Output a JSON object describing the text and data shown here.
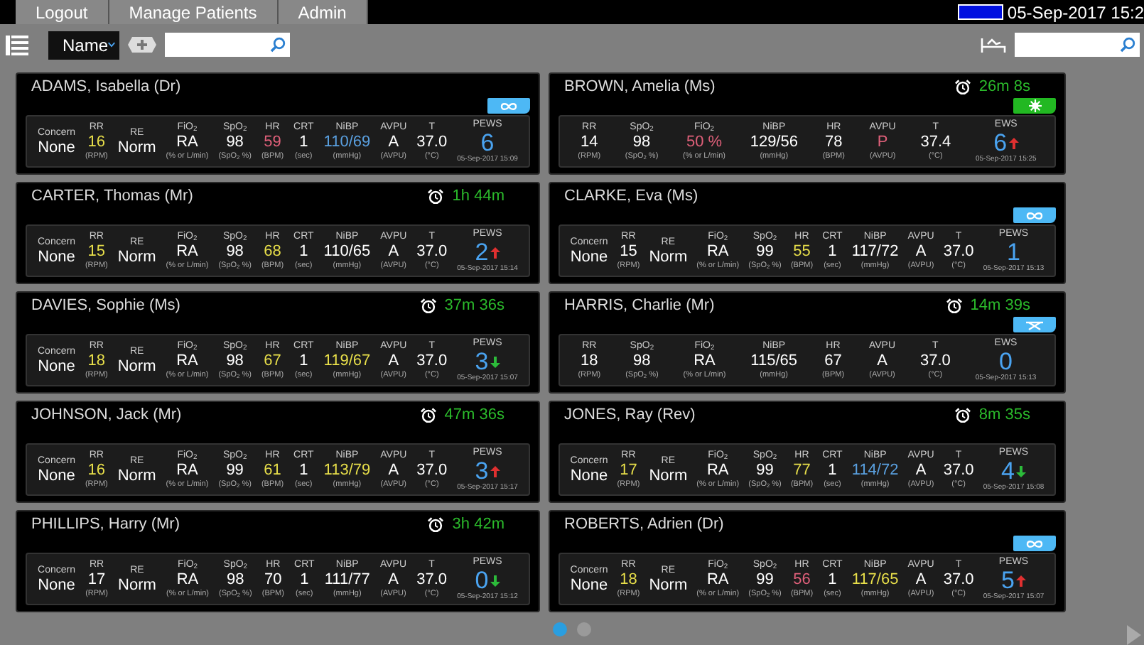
{
  "top_bar": {
    "tabs": [
      "Logout",
      "Manage Patients",
      "Admin"
    ],
    "datetime": "05-Sep-2017 15:2"
  },
  "toolbar": {
    "sort": "Name"
  },
  "cards": [
    {
      "name": "ADAMS, Isabella (Dr)",
      "badge": {
        "kind": "infinity",
        "color": "#4db8f5"
      },
      "vitals": [
        {
          "label": "Concern",
          "value": "None",
          "color": "#ffffff"
        },
        {
          "label": "RR",
          "value": "16",
          "unit": "(RPM)",
          "color": "#e8df4a"
        },
        {
          "label": "RE",
          "value": "Norm",
          "color": "#ffffff"
        },
        {
          "label": "FiO$_{2}$",
          "value": "RA",
          "unit": "(% or L/min)",
          "color": "#ffffff"
        },
        {
          "label": "SpO$_{2}$",
          "value": "98",
          "unit": "(SpO$_{2}$ %)",
          "color": "#ffffff"
        },
        {
          "label": "HR",
          "value": "59",
          "unit": "(BPM)",
          "color": "#e0607a"
        },
        {
          "label": "CRT",
          "value": "1",
          "unit": "(sec)",
          "color": "#ffffff"
        },
        {
          "label": "NiBP",
          "value": "110/69",
          "unit": "(mmHg)",
          "color": "#5aa0e0"
        },
        {
          "label": "AVPU",
          "value": "A",
          "unit": "(AVPU)",
          "color": "#ffffff"
        },
        {
          "label": "T",
          "value": "37.0",
          "unit": "(°C)",
          "color": "#ffffff"
        }
      ],
      "score": {
        "label": "PEWS",
        "value": "6",
        "date": "05-Sep-2017 15:09"
      }
    },
    {
      "name": "BROWN, Amelia (Ms)",
      "timer": "26m 8s",
      "badge": {
        "kind": "sun",
        "color": "#22b822"
      },
      "vitals": [
        {
          "label": "RR",
          "value": "14",
          "unit": "(RPM)",
          "color": "#ffffff"
        },
        {
          "label": "SpO$_{2}$",
          "value": "98",
          "unit": "(SpO$_{2}$ %)",
          "color": "#ffffff"
        },
        {
          "label": "FiO$_{2}$",
          "value": "50 %",
          "unit": "(% or L/min)",
          "color": "#e0607a"
        },
        {
          "label": "NiBP",
          "value": "129/56",
          "unit": "(mmHg)",
          "color": "#ffffff"
        },
        {
          "label": "HR",
          "value": "78",
          "unit": "(BPM)",
          "color": "#ffffff"
        },
        {
          "label": "AVPU",
          "value": "P",
          "unit": "(AVPU)",
          "color": "#e0607a"
        },
        {
          "label": "T",
          "value": "37.4",
          "unit": "(°C)",
          "color": "#ffffff"
        }
      ],
      "score": {
        "label": "EWS",
        "value": "6",
        "rising": true,
        "date": "05-Sep-2017 15:25"
      }
    },
    {
      "name": "CARTER, Thomas (Mr)",
      "timer": "1h 44m",
      "vitals": [
        {
          "label": "Concern",
          "value": "None",
          "color": "#ffffff"
        },
        {
          "label": "RR",
          "value": "15",
          "unit": "(RPM)",
          "color": "#e8df4a"
        },
        {
          "label": "RE",
          "value": "Norm",
          "color": "#ffffff"
        },
        {
          "label": "FiO$_{2}$",
          "value": "RA",
          "unit": "(% or L/min)",
          "color": "#ffffff"
        },
        {
          "label": "SpO$_{2}$",
          "value": "98",
          "unit": "(SpO$_{2}$ %)",
          "color": "#ffffff"
        },
        {
          "label": "HR",
          "value": "68",
          "unit": "(BPM)",
          "color": "#e8df4a"
        },
        {
          "label": "CRT",
          "value": "1",
          "unit": "(sec)",
          "color": "#ffffff"
        },
        {
          "label": "NiBP",
          "value": "110/65",
          "unit": "(mmHg)",
          "color": "#ffffff"
        },
        {
          "label": "AVPU",
          "value": "A",
          "unit": "(AVPU)",
          "color": "#ffffff"
        },
        {
          "label": "T",
          "value": "37.0",
          "unit": "(°C)",
          "color": "#ffffff"
        }
      ],
      "score": {
        "label": "PEWS",
        "value": "2",
        "rising": true,
        "date": "05-Sep-2017 15:14"
      }
    },
    {
      "name": "CLARKE, Eva (Ms)",
      "badge": {
        "kind": "infinity",
        "color": "#4db8f5"
      },
      "vitals": [
        {
          "label": "Concern",
          "value": "None",
          "color": "#ffffff"
        },
        {
          "label": "RR",
          "value": "15",
          "unit": "(RPM)",
          "color": "#ffffff"
        },
        {
          "label": "RE",
          "value": "Norm",
          "color": "#ffffff"
        },
        {
          "label": "FiO$_{2}$",
          "value": "RA",
          "unit": "(% or L/min)",
          "color": "#ffffff"
        },
        {
          "label": "SpO$_{2}$",
          "value": "99",
          "unit": "(SpO$_{2}$ %)",
          "color": "#ffffff"
        },
        {
          "label": "HR",
          "value": "55",
          "unit": "(BPM)",
          "color": "#e8df4a"
        },
        {
          "label": "CRT",
          "value": "1",
          "unit": "(sec)",
          "color": "#ffffff"
        },
        {
          "label": "NiBP",
          "value": "117/72",
          "unit": "(mmHg)",
          "color": "#ffffff"
        },
        {
          "label": "AVPU",
          "value": "A",
          "unit": "(AVPU)",
          "color": "#ffffff"
        },
        {
          "label": "T",
          "value": "37.0",
          "unit": "(°C)",
          "color": "#ffffff"
        }
      ],
      "score": {
        "label": "PEWS",
        "value": "1",
        "date": "05-Sep-2017 15:13"
      }
    },
    {
      "name": "DAVIES, Sophie (Ms)",
      "timer": "37m 36s",
      "vitals": [
        {
          "label": "Concern",
          "value": "None",
          "color": "#ffffff"
        },
        {
          "label": "RR",
          "value": "18",
          "unit": "(RPM)",
          "color": "#e8df4a"
        },
        {
          "label": "RE",
          "value": "Norm",
          "color": "#ffffff"
        },
        {
          "label": "FiO$_{2}$",
          "value": "RA",
          "unit": "(% or L/min)",
          "color": "#ffffff"
        },
        {
          "label": "SpO$_{2}$",
          "value": "98",
          "unit": "(SpO$_{2}$ %)",
          "color": "#ffffff"
        },
        {
          "label": "HR",
          "value": "67",
          "unit": "(BPM)",
          "color": "#e8df4a"
        },
        {
          "label": "CRT",
          "value": "1",
          "unit": "(sec)",
          "color": "#ffffff"
        },
        {
          "label": "NiBP",
          "value": "119/67",
          "unit": "(mmHg)",
          "color": "#e8df4a"
        },
        {
          "label": "AVPU",
          "value": "A",
          "unit": "(AVPU)",
          "color": "#ffffff"
        },
        {
          "label": "T",
          "value": "37.0",
          "unit": "(°C)",
          "color": "#ffffff"
        }
      ],
      "score": {
        "label": "PEWS",
        "value": "3",
        "falling": true,
        "date": "05-Sep-2017 15:07"
      }
    },
    {
      "name": "HARRIS, Charlie (Mr)",
      "timer": "14m 39s",
      "badge": {
        "kind": "bed",
        "color": "#4db8f5"
      },
      "vitals": [
        {
          "label": "RR",
          "value": "18",
          "unit": "(RPM)",
          "color": "#ffffff"
        },
        {
          "label": "SpO$_{2}$",
          "value": "98",
          "unit": "(SpO$_{2}$ %)",
          "color": "#ffffff"
        },
        {
          "label": "FiO$_{2}$",
          "value": "RA",
          "unit": "(% or L/min)",
          "color": "#ffffff"
        },
        {
          "label": "NiBP",
          "value": "115/65",
          "unit": "(mmHg)",
          "color": "#ffffff"
        },
        {
          "label": "HR",
          "value": "67",
          "unit": "(BPM)",
          "color": "#ffffff"
        },
        {
          "label": "AVPU",
          "value": "A",
          "unit": "(AVPU)",
          "color": "#ffffff"
        },
        {
          "label": "T",
          "value": "37.0",
          "unit": "(°C)",
          "color": "#ffffff"
        }
      ],
      "score": {
        "label": "EWS",
        "value": "0",
        "date": "05-Sep-2017 15:13"
      }
    },
    {
      "name": "JOHNSON, Jack (Mr)",
      "timer": "47m 36s",
      "vitals": [
        {
          "label": "Concern",
          "value": "None",
          "color": "#ffffff"
        },
        {
          "label": "RR",
          "value": "16",
          "unit": "(RPM)",
          "color": "#e8df4a"
        },
        {
          "label": "RE",
          "value": "Norm",
          "color": "#ffffff"
        },
        {
          "label": "FiO$_{2}$",
          "value": "RA",
          "unit": "(% or L/min)",
          "color": "#ffffff"
        },
        {
          "label": "SpO$_{2}$",
          "value": "99",
          "unit": "(SpO$_{2}$ %)",
          "color": "#ffffff"
        },
        {
          "label": "HR",
          "value": "61",
          "unit": "(BPM)",
          "color": "#e8df4a"
        },
        {
          "label": "CRT",
          "value": "1",
          "unit": "(sec)",
          "color": "#ffffff"
        },
        {
          "label": "NiBP",
          "value": "113/79",
          "unit": "(mmHg)",
          "color": "#e8df4a"
        },
        {
          "label": "AVPU",
          "value": "A",
          "unit": "(AVPU)",
          "color": "#ffffff"
        },
        {
          "label": "T",
          "value": "37.0",
          "unit": "(°C)",
          "color": "#ffffff"
        }
      ],
      "score": {
        "label": "PEWS",
        "value": "3",
        "rising": true,
        "date": "05-Sep-2017 15:17"
      }
    },
    {
      "name": "JONES, Ray (Rev)",
      "timer": "8m 35s",
      "vitals": [
        {
          "label": "Concern",
          "value": "None",
          "color": "#ffffff"
        },
        {
          "label": "RR",
          "value": "17",
          "unit": "(RPM)",
          "color": "#e8df4a"
        },
        {
          "label": "RE",
          "value": "Norm",
          "color": "#ffffff"
        },
        {
          "label": "FiO$_{2}$",
          "value": "RA",
          "unit": "(% or L/min)",
          "color": "#ffffff"
        },
        {
          "label": "SpO$_{2}$",
          "value": "99",
          "unit": "(SpO$_{2}$ %)",
          "color": "#ffffff"
        },
        {
          "label": "HR",
          "value": "77",
          "unit": "(BPM)",
          "color": "#e8df4a"
        },
        {
          "label": "CRT",
          "value": "1",
          "unit": "(sec)",
          "color": "#ffffff"
        },
        {
          "label": "NiBP",
          "value": "114/72",
          "unit": "(mmHg)",
          "color": "#5aa0e0"
        },
        {
          "label": "AVPU",
          "value": "A",
          "unit": "(AVPU)",
          "color": "#ffffff"
        },
        {
          "label": "T",
          "value": "37.0",
          "unit": "(°C)",
          "color": "#ffffff"
        }
      ],
      "score": {
        "label": "PEWS",
        "value": "4",
        "falling": true,
        "date": "05-Sep-2017 15:08"
      }
    },
    {
      "name": "PHILLIPS, Harry (Mr)",
      "timer": "3h 42m",
      "vitals": [
        {
          "label": "Concern",
          "value": "None",
          "color": "#ffffff"
        },
        {
          "label": "RR",
          "value": "17",
          "unit": "(RPM)",
          "color": "#ffffff"
        },
        {
          "label": "RE",
          "value": "Norm",
          "color": "#ffffff"
        },
        {
          "label": "FiO$_{2}$",
          "value": "RA",
          "unit": "(% or L/min)",
          "color": "#ffffff"
        },
        {
          "label": "SpO$_{2}$",
          "value": "98",
          "unit": "(SpO$_{2}$ %)",
          "color": "#ffffff"
        },
        {
          "label": "HR",
          "value": "70",
          "unit": "(BPM)",
          "color": "#ffffff"
        },
        {
          "label": "CRT",
          "value": "1",
          "unit": "(sec)",
          "color": "#ffffff"
        },
        {
          "label": "NiBP",
          "value": "111/77",
          "unit": "(mmHg)",
          "color": "#ffffff"
        },
        {
          "label": "AVPU",
          "value": "A",
          "unit": "(AVPU)",
          "color": "#ffffff"
        },
        {
          "label": "T",
          "value": "37.0",
          "unit": "(°C)",
          "color": "#ffffff"
        }
      ],
      "score": {
        "label": "PEWS",
        "value": "0",
        "falling": true,
        "date": "05-Sep-2017 15:12"
      }
    },
    {
      "name": "ROBERTS, Adrien (Dr)",
      "badge": {
        "kind": "infinity",
        "color": "#4db8f5"
      },
      "vitals": [
        {
          "label": "Concern",
          "value": "None",
          "color": "#ffffff"
        },
        {
          "label": "RR",
          "value": "18",
          "unit": "(RPM)",
          "color": "#e8df4a"
        },
        {
          "label": "RE",
          "value": "Norm",
          "color": "#ffffff"
        },
        {
          "label": "FiO$_{2}$",
          "value": "RA",
          "unit": "(% or L/min)",
          "color": "#ffffff"
        },
        {
          "label": "SpO$_{2}$",
          "value": "99",
          "unit": "(SpO$_{2}$ %)",
          "color": "#ffffff"
        },
        {
          "label": "HR",
          "value": "56",
          "unit": "(BPM)",
          "color": "#e0607a"
        },
        {
          "label": "CRT",
          "value": "1",
          "unit": "(sec)",
          "color": "#ffffff"
        },
        {
          "label": "NiBP",
          "value": "117/65",
          "unit": "(mmHg)",
          "color": "#e8df4a"
        },
        {
          "label": "AVPU",
          "value": "A",
          "unit": "(AVPU)",
          "color": "#ffffff"
        },
        {
          "label": "T",
          "value": "37.0",
          "unit": "(°C)",
          "color": "#ffffff"
        }
      ],
      "score": {
        "label": "PEWS",
        "value": "5",
        "rising": true,
        "date": "05-Sep-2017 15:07"
      }
    }
  ],
  "pages": [
    {
      "selected": true
    },
    {
      "selected": false
    }
  ]
}
